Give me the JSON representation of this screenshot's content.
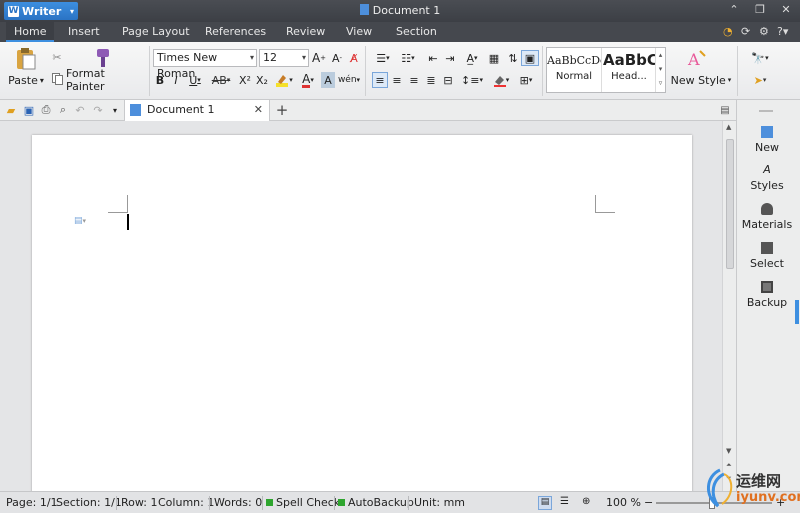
{
  "app": {
    "name": "Writer",
    "doc_title": "Document 1"
  },
  "menu": {
    "tabs": [
      "Home",
      "Insert",
      "Page Layout",
      "References",
      "Review",
      "View",
      "Section"
    ]
  },
  "ribbon": {
    "paste": "Paste",
    "format_painter": "Format Painter",
    "font_name": "Times New Roman",
    "font_size": "12",
    "bold": "B",
    "italic": "I",
    "underline": "U",
    "strike": "AB",
    "superscript": "X²",
    "subscript": "X₂",
    "style_normal_preview": "AaBbCcDd",
    "style_normal_name": "Normal",
    "style_heading_preview": "AaBbC",
    "style_heading_name": "Head...",
    "new_style": "New Style"
  },
  "tabbar": {
    "doc_tab": "Document 1"
  },
  "right_panel": {
    "items": [
      "New",
      "Styles",
      "Materials",
      "Select",
      "Backup"
    ]
  },
  "status": {
    "page": "Page: 1/1",
    "section": "Section: 1/1",
    "row": "Row: 1",
    "column": "Column: 1",
    "words": "Words: 0",
    "spell_check": "Spell Check",
    "autobackup": "AutoBackup",
    "unit": "Unit: mm",
    "zoom": "100 %"
  },
  "watermark": {
    "text_cn": "运维网",
    "text_url": "iyunv.com"
  },
  "colors": {
    "accent": "#3d8fe0",
    "titlebar": "#3c3f45",
    "status_green": "#2ea52e"
  }
}
